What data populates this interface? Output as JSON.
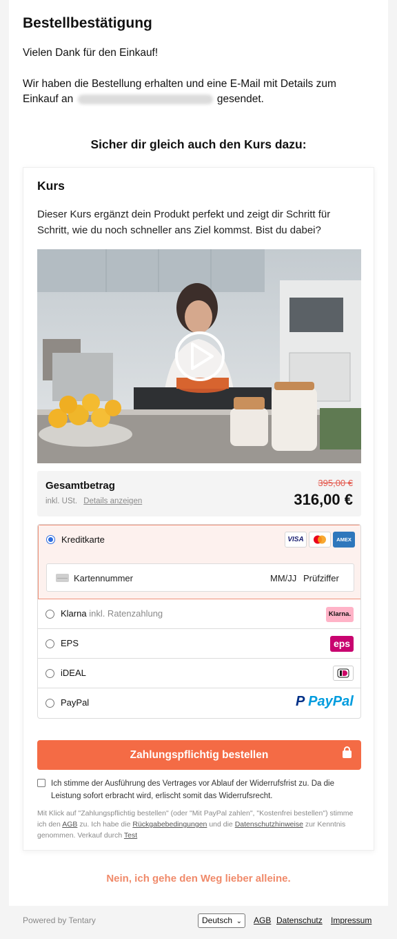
{
  "page": {
    "title": "Bestellbestätigung",
    "thanks": "Vielen Dank für den Einkauf!",
    "info_before": "Wir haben die Bestellung erhalten und eine E-Mail mit Details zum Einkauf an",
    "info_after": "gesendet.",
    "upsell_heading": "Sicher dir gleich auch den Kurs dazu:"
  },
  "card": {
    "title": "Kurs",
    "description": "Dieser Kurs ergänzt dein Produkt perfekt und zeigt dir Schritt für Schritt, wie du noch schneller ans Ziel kommst. Bist du dabei?",
    "video_icon": "play-icon"
  },
  "total": {
    "label": "Gesamtbetrag",
    "tax_note": "inkl. USt.",
    "details_link": "Details anzeigen",
    "old_price": "395,00 €",
    "price": "316,00 €"
  },
  "payment": {
    "options": [
      {
        "label": "Kreditkarte",
        "selected": true
      },
      {
        "label": "Klarna",
        "sublabel": "inkl. Ratenzahlung",
        "selected": false
      },
      {
        "label": "EPS",
        "selected": false
      },
      {
        "label": "iDEAL",
        "selected": false
      },
      {
        "label": "PayPal",
        "selected": false
      }
    ],
    "card_logos": [
      "VISA",
      "AMEX"
    ],
    "klarna_logo": "Klarna.",
    "eps_logo": "eps",
    "paypal_logo_p": "P",
    "paypal_logo_text": "PayPal",
    "card_number_placeholder": "Kartennummer",
    "expiry_placeholder": "MM/JJ",
    "cvc_placeholder": "Prüfziffer"
  },
  "cta": {
    "label": "Zahlungspflichtig bestellen"
  },
  "consent": {
    "text": "Ich stimme der Ausführung des Vertrages vor Ablauf der Widerrufsfrist zu. Da die Leistung sofort erbracht wird, erlischt somit das Widerrufsrecht."
  },
  "legal": {
    "part1": "Mit Klick auf \"Zahlungspflichtig bestellen\" (oder \"Mit PayPal zahlen\", \"Kostenfrei bestellen\") stimme ich den",
    "agb": "AGB",
    "part2": "zu. Ich habe die",
    "returns": "Rückgabebedingungen",
    "part3": "und die",
    "privacy": "Datenschutzhinweise",
    "part4": "zur Kenntnis genommen. Verkauf durch",
    "seller": "Test"
  },
  "decline": "Nein, ich gehe den Weg lieber alleine.",
  "footer": {
    "powered": "Powered by Tentary",
    "language": "Deutsch",
    "links": [
      "AGB",
      "Datenschutz",
      "Impressum"
    ]
  },
  "colors": {
    "accent": "#f46b45",
    "selected_bg": "#fdf1ee",
    "radio": "#2d6de0",
    "old_price": "#e3574b"
  }
}
